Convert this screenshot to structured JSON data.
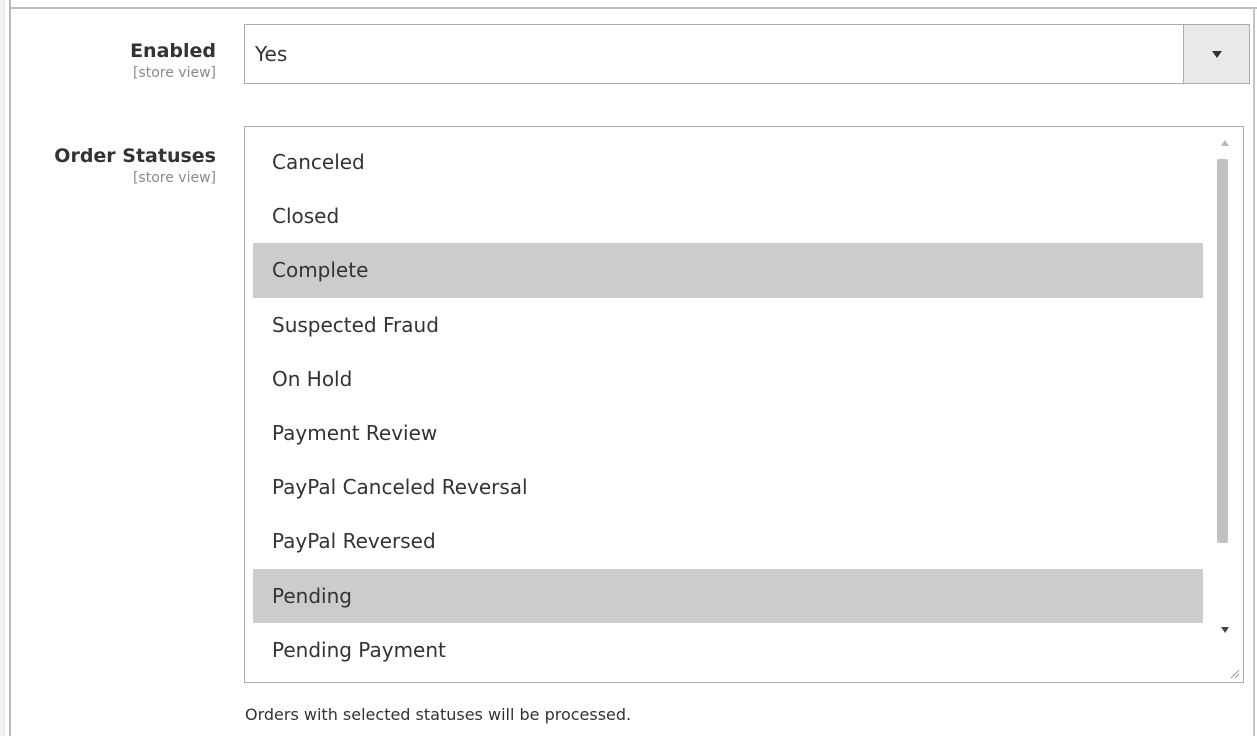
{
  "fields": {
    "enabled": {
      "label": "Enabled",
      "scope": "[store view]",
      "value": "Yes"
    },
    "order_statuses": {
      "label": "Order Statuses",
      "scope": "[store view]",
      "options": [
        {
          "label": "Canceled",
          "selected": false
        },
        {
          "label": "Closed",
          "selected": false
        },
        {
          "label": "Complete",
          "selected": true
        },
        {
          "label": "Suspected Fraud",
          "selected": false
        },
        {
          "label": "On Hold",
          "selected": false
        },
        {
          "label": "Payment Review",
          "selected": false
        },
        {
          "label": "PayPal Canceled Reversal",
          "selected": false
        },
        {
          "label": "PayPal Reversed",
          "selected": false
        },
        {
          "label": "Pending",
          "selected": true
        },
        {
          "label": "Pending Payment",
          "selected": false
        }
      ],
      "note": "Orders with selected statuses will be processed."
    }
  },
  "colors": {
    "selected_option_bg": "#cccccc",
    "border": "#adadad",
    "arrow_button_bg": "#e9e9e9",
    "text": "#333333",
    "scope_text": "#8a8a8a"
  },
  "icons": {
    "select_arrow": "triangle-down-icon",
    "scroll_up": "scroll-up-arrow-icon",
    "scroll_down": "scroll-down-arrow-icon",
    "resize": "resize-grip-icon"
  }
}
